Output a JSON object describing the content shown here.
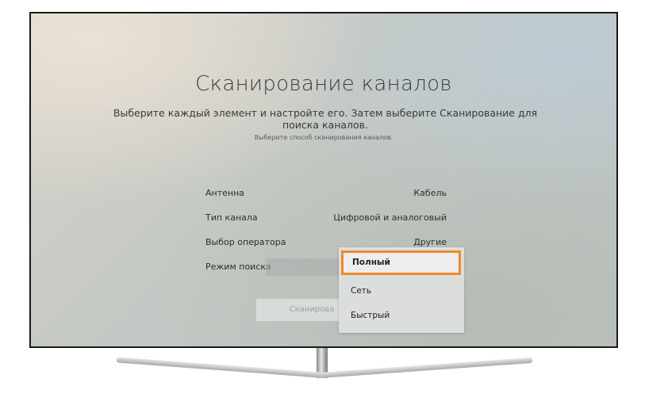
{
  "screen": {
    "title": "Сканирование каналов",
    "subtitle": "Выберите каждый элемент и настройте его. Затем выберите Сканирование для поиска каналов.",
    "hint": "Выберите способ сканирования каналов."
  },
  "settings": [
    {
      "label": "Антенна",
      "value": "Кабель"
    },
    {
      "label": "Тип канала",
      "value": "Цифровой и аналоговый"
    },
    {
      "label": "Выбор оператора",
      "value": "Другие"
    },
    {
      "label": "Режим поиска",
      "value": ""
    }
  ],
  "scan_button": {
    "label": "Сканирова"
  },
  "dropdown": {
    "options": [
      "Полный",
      "Сеть",
      "Быстрый"
    ],
    "selected": "Полный"
  },
  "colors": {
    "highlight": "#f0892a",
    "bezel": "#1a1a1a"
  }
}
